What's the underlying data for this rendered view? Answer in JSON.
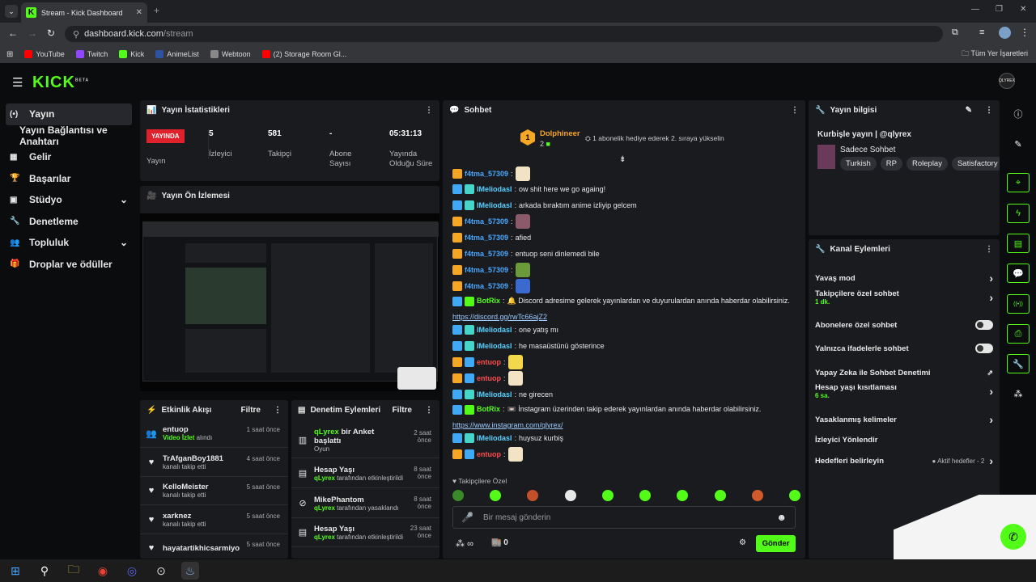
{
  "browser": {
    "tab_title": "Stream - Kick Dashboard",
    "url_host": "dashboard.kick.com",
    "url_path": "/stream",
    "bookmarks": [
      {
        "label": "YouTube",
        "color": "#ff0000"
      },
      {
        "label": "Twitch",
        "color": "#9146ff"
      },
      {
        "label": "Kick",
        "color": "#53fc18"
      },
      {
        "label": "AnimeList",
        "color": "#2e51a2"
      },
      {
        "label": "Webtoon",
        "color": "#888888"
      },
      {
        "label": "(2) Storage Room Gl...",
        "color": "#ff0000"
      }
    ],
    "all_bookmarks": "Tüm Yer İşaretleri"
  },
  "app": {
    "logo": "KICK",
    "logo_tag": "BETA",
    "avatar": "QLYREX"
  },
  "nav": [
    {
      "label": "Yayın",
      "icon": "(•)"
    },
    {
      "label": "Yayın Bağlantısı ve Anahtarı",
      "icon": ""
    },
    {
      "label": "Gelir",
      "icon": "▦"
    },
    {
      "label": "Başarılar",
      "icon": "🏆"
    },
    {
      "label": "Stüdyo",
      "icon": "▣",
      "chev": "⌄"
    },
    {
      "label": "Denetleme",
      "icon": "🔧"
    },
    {
      "label": "Topluluk",
      "icon": "👥",
      "chev": "⌄"
    },
    {
      "label": "Droplar ve ödüller",
      "icon": "🎁"
    }
  ],
  "stats": {
    "title": "Yayın İstatistikleri",
    "live_badge": "YAYINDA",
    "items": [
      {
        "value": "",
        "label": "Yayın"
      },
      {
        "value": "5",
        "label": "İzleyici"
      },
      {
        "value": "581",
        "label": "Takipçi"
      },
      {
        "value": "-",
        "label": "Abone Sayısı"
      },
      {
        "value": "05:31:13",
        "label": "Yayında Olduğu Süre"
      }
    ]
  },
  "preview": {
    "title": "Yayın Ön İzlemesi"
  },
  "activity": {
    "title": "Etkinlik Akışı",
    "filter": "Filtre",
    "items": [
      {
        "name": "entuop",
        "sub_green": "Video İzlet",
        "sub": "alındı",
        "time": "1 saat önce",
        "icon": "👥"
      },
      {
        "name": "TrAfganBoy1881",
        "sub_green": "",
        "sub": "kanalı takip etti",
        "time": "4 saat önce",
        "icon": "♥"
      },
      {
        "name": "KelloMeister",
        "sub_green": "",
        "sub": "kanalı takip etti",
        "time": "5 saat önce",
        "icon": "♥"
      },
      {
        "name": "xarknez",
        "sub_green": "",
        "sub": "kanalı takip etti",
        "time": "5 saat önce",
        "icon": "♥"
      },
      {
        "name": "hayatartikhicsarmiyo",
        "sub_green": "",
        "sub": "",
        "time": "5 saat önce",
        "icon": "♥"
      }
    ]
  },
  "moderation": {
    "title": "Denetim Eylemleri",
    "filter": "Filtre",
    "items": [
      {
        "name_green": "qLyrex",
        "name": "bir Anket başlattı",
        "sub": "Oyun",
        "time": "2 saat önce",
        "icon": "▥"
      },
      {
        "name_green": "",
        "name": "Hesap Yaşı",
        "sub_green": "qLyrex",
        "sub": "tarafından etkinleştirildi",
        "time": "8 saat önce",
        "icon": "▤"
      },
      {
        "name_green": "",
        "name": "MikePhantom",
        "sub_green": "qLyrex",
        "sub": "tarafından yasaklandı",
        "time": "8 saat önce",
        "icon": "⊘"
      },
      {
        "name_green": "",
        "name": "Hesap Yaşı",
        "sub_green": "qLyrex",
        "sub": "tarafından etkinleştirildi",
        "time": "23 saat önce",
        "icon": "▤"
      }
    ]
  },
  "chat": {
    "title": "Sohbet",
    "top_gifter": "Dolphineer",
    "top_gifter_rank": "1",
    "top_gifter_count": "2",
    "promo": "1 abonelik hediye ederek 2. sıraya yükselin",
    "messages": [
      {
        "user": "f4tma_57309",
        "color": "#4aa8ff",
        "text": "",
        "emote": "#f3e3c5",
        "badges": [
          "#f5a623"
        ]
      },
      {
        "user": "IMeliodasI",
        "color": "#5ad0ff",
        "text": "ow shit here we go againg!",
        "badges": [
          "#3fa9f5",
          "#46d5c8"
        ]
      },
      {
        "user": "IMeliodasI",
        "color": "#5ad0ff",
        "text": "arkada bıraktım anime izliyip gelcem",
        "badges": [
          "#3fa9f5",
          "#46d5c8"
        ]
      },
      {
        "user": "f4tma_57309",
        "color": "#4aa8ff",
        "text": "",
        "emote": "#8a5a6a",
        "badges": [
          "#f5a623"
        ]
      },
      {
        "user": "f4tma_57309",
        "color": "#4aa8ff",
        "text": "afied",
        "badges": [
          "#f5a623"
        ]
      },
      {
        "user": "f4tma_57309",
        "color": "#4aa8ff",
        "text": "entuop seni dinlemedi bile",
        "badges": [
          "#f5a623"
        ]
      },
      {
        "user": "f4tma_57309",
        "color": "#4aa8ff",
        "text": "",
        "emote": "#6a9a3a",
        "badges": [
          "#f5a623"
        ]
      },
      {
        "user": "f4tma_57309",
        "color": "#4aa8ff",
        "text": "",
        "emote": "#3a6ad0",
        "badges": [
          "#f5a623"
        ]
      },
      {
        "user": "BotRix",
        "color": "#53fc18",
        "text": "🔔 Discord adresime gelerek yayınlardan ve duyurulardan anında haberdar olabilirsiniz.",
        "link": "https://discord.gg/rwTc66ajZ2",
        "badges": [
          "#3fa9f5",
          "#53fc18"
        ]
      },
      {
        "user": "IMeliodasI",
        "color": "#5ad0ff",
        "text": "one yatış mı",
        "badges": [
          "#3fa9f5",
          "#46d5c8"
        ]
      },
      {
        "user": "IMeliodasI",
        "color": "#5ad0ff",
        "text": "he masaüstünü gösterince",
        "badges": [
          "#3fa9f5",
          "#46d5c8"
        ]
      },
      {
        "user": "entuop",
        "color": "#ff4d4d",
        "text": "",
        "emote": "#f2d84a",
        "badges": [
          "#f5a623",
          "#3fa9f5"
        ]
      },
      {
        "user": "entuop",
        "color": "#ff4d4d",
        "text": "",
        "emote": "#f3e3c5",
        "badges": [
          "#f5a623",
          "#3fa9f5"
        ]
      },
      {
        "user": "IMeliodasI",
        "color": "#5ad0ff",
        "text": "ne girecen",
        "badges": [
          "#3fa9f5",
          "#46d5c8"
        ]
      },
      {
        "user": "BotRix",
        "color": "#53fc18",
        "text": "📼 İnstagram üzerinden takip ederek yayınlardan anında haberdar olabilirsiniz.",
        "link": "https://www.instagram.com/qlyrex/",
        "badges": [
          "#3fa9f5",
          "#53fc18"
        ]
      },
      {
        "user": "IMeliodasI",
        "color": "#5ad0ff",
        "text": "huysuz kurbiş",
        "badges": [
          "#3fa9f5",
          "#46d5c8"
        ]
      },
      {
        "user": "entuop",
        "color": "#ff4d4d",
        "text": "",
        "emote": "#f3e3c5",
        "badges": [
          "#f5a623",
          "#3fa9f5"
        ]
      }
    ],
    "followers_only": "♥ Takipçilere Özel",
    "emotes": [
      "#3a8a2a",
      "#53fc18",
      "#c2502a",
      "#e8e8e8",
      "#53fc18",
      "#53fc18",
      "#53fc18",
      "#53fc18",
      "#d05a2a",
      "#53fc18"
    ],
    "placeholder": "Bir mesaj gönderin",
    "points": "∞",
    "shop_count": "0",
    "send": "Gönder"
  },
  "info": {
    "title": "Yayın bilgisi",
    "stream_title": "Kurbişle yayın | @qlyrex",
    "category": "Sadece Sohbet",
    "tags": [
      "Turkish",
      "RP",
      "Roleplay",
      "Satisfactory"
    ]
  },
  "channel_actions": {
    "title": "Kanal Eylemleri",
    "rows": [
      {
        "label": "Yavaş mod",
        "sub": "",
        "kind": "chev"
      },
      {
        "label": "Takipçilere özel sohbet",
        "sub": "1 dk.",
        "kind": "chev"
      },
      {
        "label": "Abonelere özel sohbet",
        "sub": "",
        "kind": "toggle"
      },
      {
        "label": "Yalnızca ifadelerle sohbet",
        "sub": "",
        "kind": "toggle"
      },
      {
        "label": "Yapay Zeka ile Sohbet Denetimi",
        "sub": "",
        "kind": "ext"
      },
      {
        "label": "Hesap yaşı kısıtlaması",
        "sub": "6 sa.",
        "kind": "chev"
      },
      {
        "label": "Yasaklanmış kelimeler",
        "sub": "",
        "kind": "chev"
      },
      {
        "label": "İzleyici Yönlendir",
        "sub": "",
        "kind": "none"
      },
      {
        "label": "Hedefleri belirleyin",
        "sub": "",
        "kind": "chev",
        "extra": "● Aktif hedefler - 2"
      }
    ]
  },
  "rail_icons": [
    "info-icon",
    "edit-icon",
    "scan-icon",
    "bolt-icon",
    "doc-icon",
    "chat-icon",
    "broadcast-icon",
    "printer-icon",
    "wrench-icon",
    "community-icon"
  ],
  "taskbar": [
    "windows-icon",
    "search-icon",
    "files-icon",
    "chrome-icon",
    "discord-icon",
    "obs-icon",
    "steam-icon"
  ]
}
